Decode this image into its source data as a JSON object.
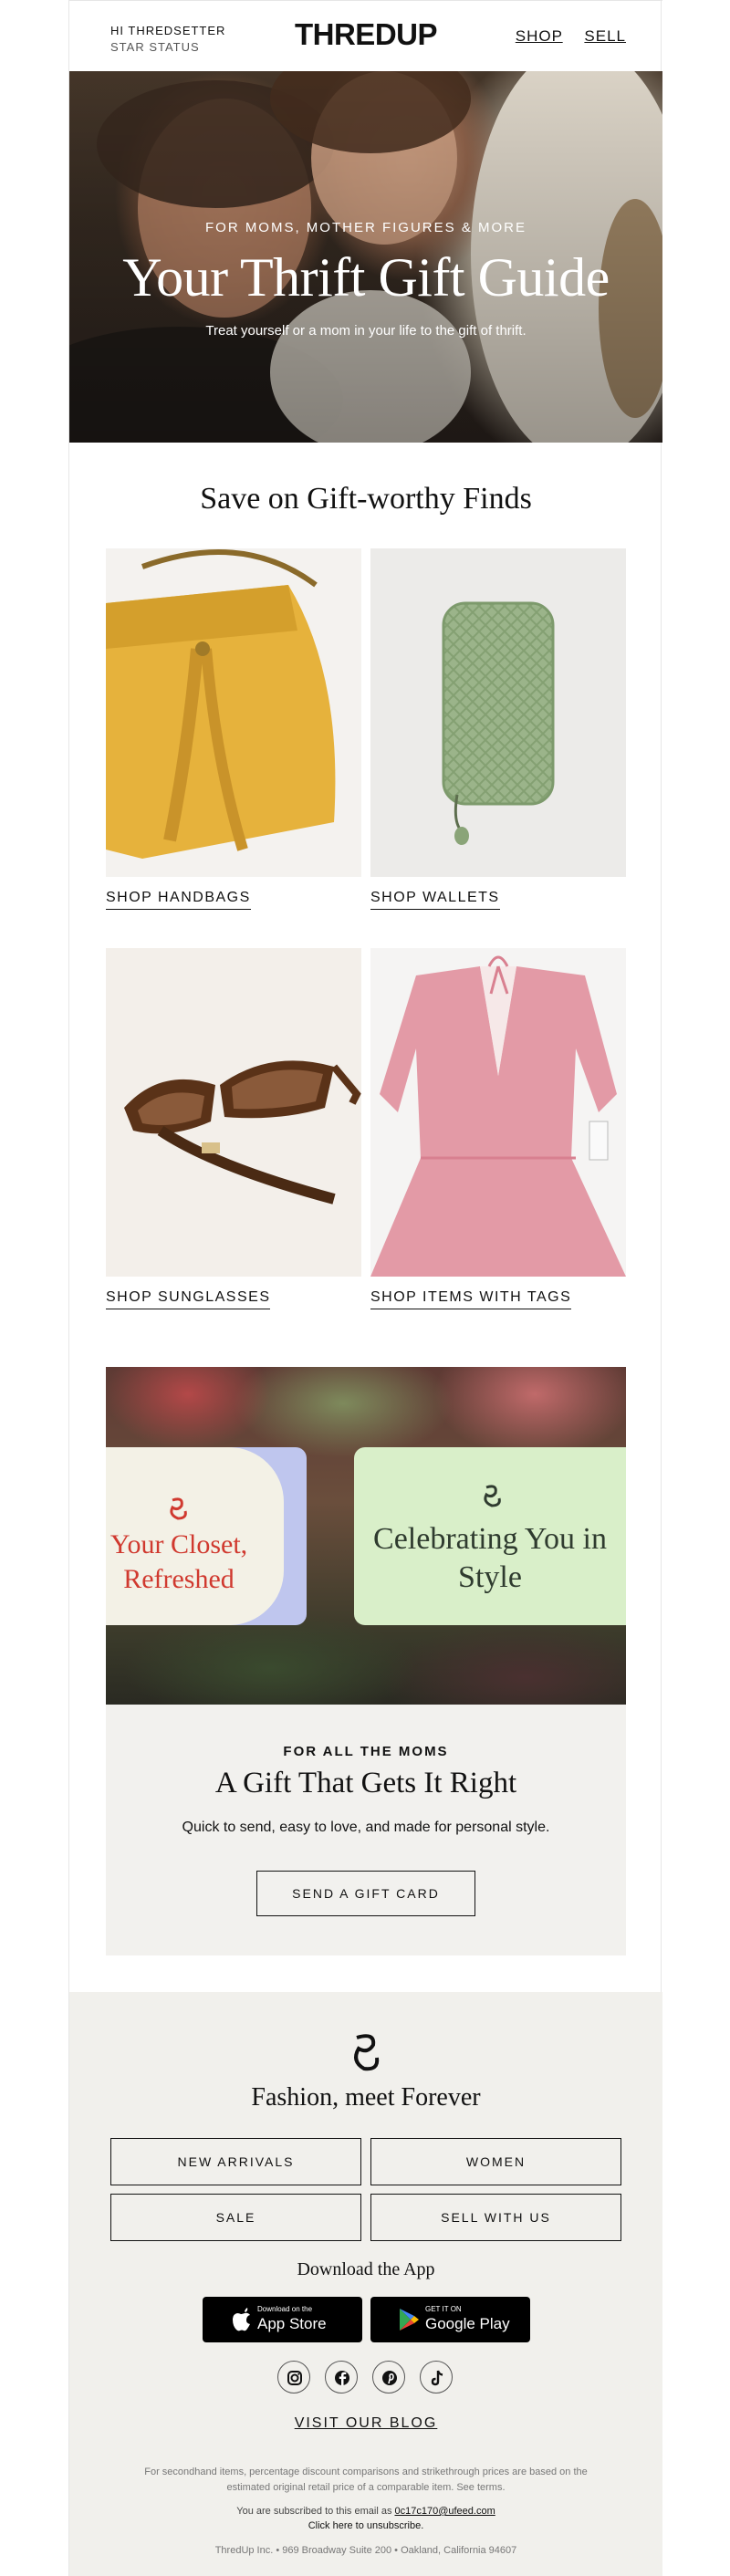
{
  "header": {
    "greeting": "HI THREDSETTER",
    "status": "STAR STATUS",
    "logo": "THREDUP",
    "nav": [
      "SHOP",
      "SELL"
    ]
  },
  "hero": {
    "pretitle": "FOR MOMS, MOTHER FIGURES & MORE",
    "title": "Your Thrift Gift Guide",
    "subtitle": "Treat yourself or a mom in your life to the gift of thrift."
  },
  "finds": {
    "title": "Save on Gift-worthy Finds",
    "tiles": [
      {
        "label": "SHOP HANDBAGS",
        "icon": "yellow-handbag-image"
      },
      {
        "label": "SHOP WALLETS",
        "icon": "green-wallet-image"
      },
      {
        "label": "SHOP SUNGLASSES",
        "icon": "sunglasses-image"
      },
      {
        "label": "SHOP ITEMS WITH TAGS",
        "icon": "pink-dress-image"
      }
    ]
  },
  "gift_card": {
    "card1_text": "Your Closet, Refreshed",
    "card2_text": "Celebrating You in Style",
    "kicker": "FOR ALL THE MOMS",
    "title": "A Gift That Gets It Right",
    "description": "Quick to send, easy to love, and made for personal style.",
    "button": "SEND A GIFT CARD",
    "card1_color": "#d0392f",
    "card2_color": "#d9efc9"
  },
  "footer": {
    "tagline": "Fashion, meet Forever",
    "buttons": [
      "NEW ARRIVALS",
      "WOMEN",
      "SALE",
      "SELL WITH US"
    ],
    "download": "Download the App",
    "app_store": {
      "small": "Download on the",
      "big": "App Store"
    },
    "google_play": {
      "small": "GET IT ON",
      "big": "Google Play"
    },
    "social": [
      "instagram-icon",
      "facebook-icon",
      "pinterest-icon",
      "tiktok-icon"
    ],
    "blog": "VISIT OUR BLOG",
    "legal": "For secondhand items, percentage discount comparisons and strikethrough prices are based on the estimated original retail price of a comparable item. See terms.",
    "subscribed_prefix": "You are subscribed to this email as ",
    "email": "0c17c170@ufeed.com",
    "unsubscribe": "Click here to unsubscribe.",
    "address": "ThredUp Inc. • 969 Broadway Suite 200 • Oakland, California 94607"
  }
}
